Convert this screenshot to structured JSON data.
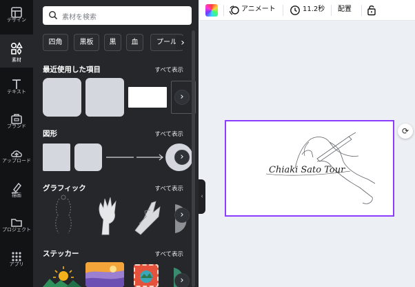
{
  "sidebar": {
    "items": [
      {
        "label": "デザイン",
        "icon": "layout-icon"
      },
      {
        "label": "素材",
        "icon": "elements-icon",
        "active": true
      },
      {
        "label": "テキスト",
        "icon": "text-icon"
      },
      {
        "label": "ブランド",
        "icon": "brand-icon"
      },
      {
        "label": "アップロード",
        "icon": "upload-icon"
      },
      {
        "label": "描画",
        "icon": "draw-icon"
      },
      {
        "label": "プロジェクト",
        "icon": "folder-icon"
      },
      {
        "label": "アプリ",
        "icon": "apps-icon"
      }
    ]
  },
  "panel": {
    "search": {
      "placeholder": "素材を検索"
    },
    "chips": [
      "四角",
      "黒板",
      "黒",
      "血",
      "プール"
    ],
    "sections": [
      {
        "title": "最近使用した項目",
        "more": "すべて表示"
      },
      {
        "title": "図形",
        "more": "すべて表示"
      },
      {
        "title": "グラフィック",
        "more": "すべて表示"
      },
      {
        "title": "ステッカー",
        "more": "すべて表示"
      }
    ]
  },
  "toolbar": {
    "animate_label": "アニメート",
    "duration": "11.2秒",
    "position_label": "配置"
  },
  "design": {
    "signature_text": "Chiaki Sato Tour"
  },
  "colors": {
    "accent": "#8b3dff",
    "rail_bg": "#121315",
    "panel_bg": "#25272b"
  }
}
